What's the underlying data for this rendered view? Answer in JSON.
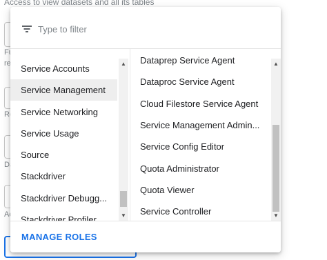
{
  "background": {
    "top_text": "Access to view datasets and all its tables",
    "labels": [
      "Fu",
      "re",
      "Re",
      "Da",
      "Ac"
    ]
  },
  "filter": {
    "placeholder": "Type to filter",
    "value": ""
  },
  "services": [
    {
      "label": "Service Accounts",
      "selected": false
    },
    {
      "label": "Service Management",
      "selected": true
    },
    {
      "label": "Service Networking",
      "selected": false
    },
    {
      "label": "Service Usage",
      "selected": false
    },
    {
      "label": "Source",
      "selected": false
    },
    {
      "label": "Stackdriver",
      "selected": false
    },
    {
      "label": "Stackdriver Debugg...",
      "selected": false
    },
    {
      "label": "Stackdriver Profiler",
      "selected": false
    }
  ],
  "roles": [
    {
      "label": "Dataprep Service Agent"
    },
    {
      "label": "Dataproc Service Agent"
    },
    {
      "label": "Cloud Filestore Service Agent"
    },
    {
      "label": "Service Management Admin..."
    },
    {
      "label": "Service Config Editor"
    },
    {
      "label": "Quota Administrator"
    },
    {
      "label": "Quota Viewer"
    },
    {
      "label": "Service Controller"
    }
  ],
  "footer": {
    "manage_label": "MANAGE ROLES"
  },
  "colors": {
    "accent": "#1a73e8",
    "selected_bg": "#eeeeee"
  },
  "icons": {
    "filter": "filter-list-icon",
    "scroll_up": "arrow-up-icon",
    "scroll_down": "arrow-down-icon"
  }
}
